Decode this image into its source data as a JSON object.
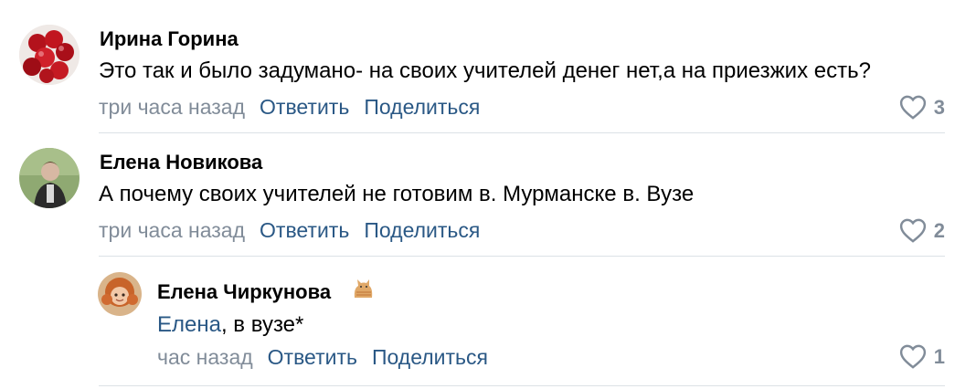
{
  "comments": [
    {
      "author": "Ирина Горина",
      "text": "Это так и было задумано- на своих учителей денег нет,а на приезжих есть?",
      "time": "три часа назад",
      "reply_label": "Ответить",
      "share_label": "Поделиться",
      "likes": "3"
    },
    {
      "author": "Елена Новикова",
      "text": "А почему своих учителей не готовим в. Мурманске в. Вузе",
      "time": "три часа назад",
      "reply_label": "Ответить",
      "share_label": "Поделиться",
      "likes": "2"
    },
    {
      "author": "Елена Чиркунова",
      "mention": "Елена",
      "text": ", в вузе*",
      "time": "час назад",
      "reply_label": "Ответить",
      "share_label": "Поделиться",
      "likes": "1",
      "author_badge_icon": "cat-icon"
    }
  ],
  "colors": {
    "link": "#2a5885",
    "muted": "#818c99",
    "divider": "#dce1e6"
  }
}
